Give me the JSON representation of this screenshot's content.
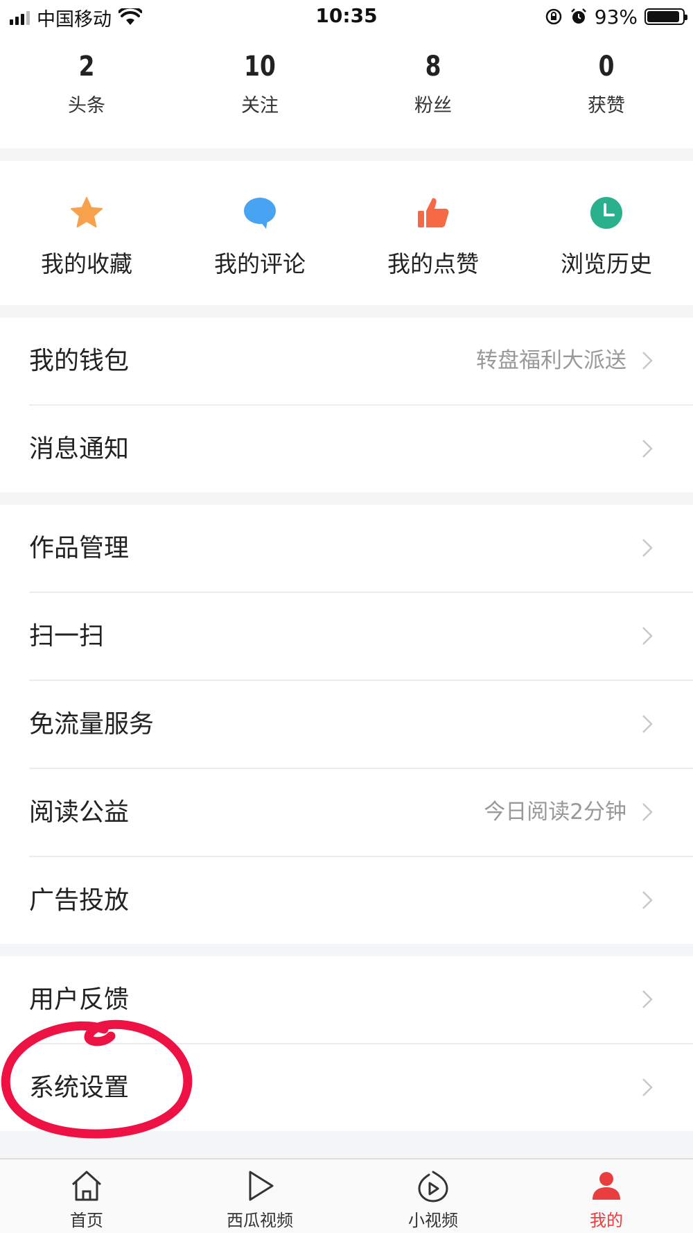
{
  "status_bar": {
    "carrier": "中国移动",
    "time": "10:35",
    "battery": "93%",
    "battery_level": 0.93
  },
  "stats": [
    {
      "value": "2",
      "label": "头条"
    },
    {
      "value": "10",
      "label": "关注"
    },
    {
      "value": "8",
      "label": "粉丝"
    },
    {
      "value": "0",
      "label": "获赞"
    }
  ],
  "quick_actions": [
    {
      "label": "我的收藏",
      "icon": "star-icon",
      "color": "#f7a24b"
    },
    {
      "label": "我的评论",
      "icon": "comment-bubble-icon",
      "color": "#48a3f2"
    },
    {
      "label": "我的点赞",
      "icon": "thumbs-up-icon",
      "color": "#f56a45"
    },
    {
      "label": "浏览历史",
      "icon": "clock-icon",
      "color": "#2bb08e"
    }
  ],
  "menu": {
    "wallet": {
      "label": "我的钱包",
      "hint": "转盘福利大派送"
    },
    "notifications": {
      "label": "消息通知"
    },
    "works": {
      "label": "作品管理"
    },
    "scan": {
      "label": "扫一扫"
    },
    "free_data": {
      "label": "免流量服务"
    },
    "reading_charity": {
      "label": "阅读公益",
      "hint": "今日阅读2分钟"
    },
    "ads": {
      "label": "广告投放"
    },
    "feedback": {
      "label": "用户反馈"
    },
    "settings": {
      "label": "系统设置"
    }
  },
  "tab_bar": [
    {
      "label": "首页",
      "icon": "home-icon"
    },
    {
      "label": "西瓜视频",
      "icon": "play-icon"
    },
    {
      "label": "小视频",
      "icon": "short-video-icon"
    },
    {
      "label": "我的",
      "icon": "profile-icon",
      "active": true
    }
  ],
  "colors": {
    "accent": "#e83e3e",
    "annotation": "#ee1144",
    "section_gap": "#f4f5f6"
  }
}
